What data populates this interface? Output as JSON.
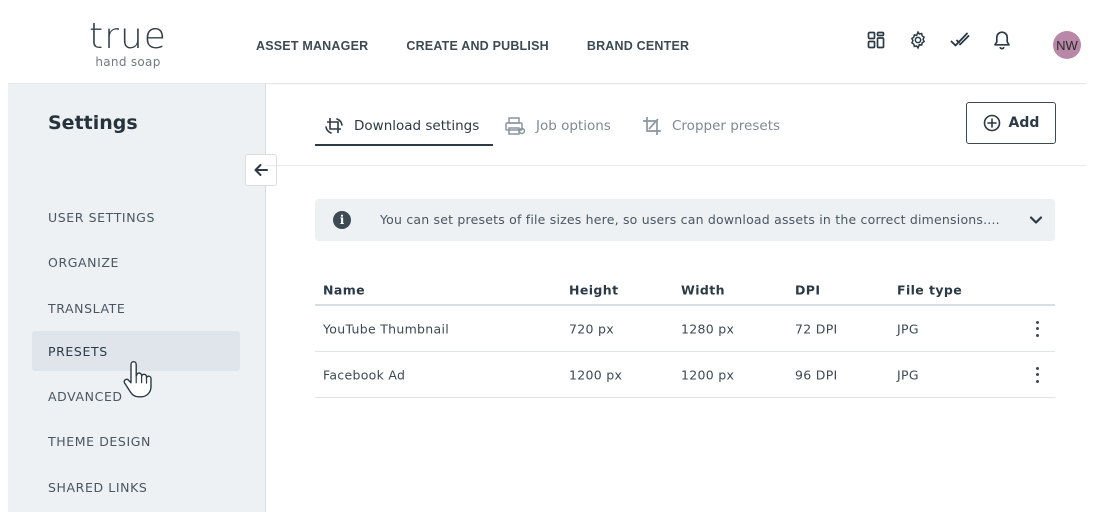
{
  "logo": {
    "word": "true",
    "sub": "hand soap"
  },
  "topnav": {
    "items": [
      "ASSET MANAGER",
      "CREATE AND PUBLISH",
      "BRAND CENTER"
    ]
  },
  "topbar_icons": [
    "apps-grid-icon",
    "gear-icon",
    "double-check-icon",
    "bell-icon"
  ],
  "user": {
    "initials": "NW",
    "avatar_color": "#b987a7"
  },
  "sidebar": {
    "title": "Settings",
    "items": [
      {
        "label": "USER SETTINGS"
      },
      {
        "label": "ORGANIZE"
      },
      {
        "label": "TRANSLATE"
      },
      {
        "label": "PRESETS",
        "active": true
      },
      {
        "label": "ADVANCED"
      },
      {
        "label": "THEME DESIGN"
      },
      {
        "label": "SHARED LINKS"
      }
    ]
  },
  "tabs": [
    {
      "label": "Download settings",
      "icon": "crop-rotate-icon",
      "active": true
    },
    {
      "label": "Job options",
      "icon": "printer-settings-icon"
    },
    {
      "label": "Cropper presets",
      "icon": "crop-icon"
    }
  ],
  "add_button": {
    "label": "Add",
    "icon": "plus-circle-icon"
  },
  "info": {
    "text": "You can set presets of file sizes here, so users can download assets in the correct dimensions...."
  },
  "table": {
    "columns": [
      "Name",
      "Height",
      "Width",
      "DPI",
      "File type"
    ],
    "rows": [
      [
        "YouTube Thumbnail",
        "720 px",
        "1280 px",
        "72 DPI",
        "JPG"
      ],
      [
        "Facebook Ad",
        "1200 px",
        "1200 px",
        "96 DPI",
        "JPG"
      ]
    ]
  },
  "colors": {
    "accent": "#2b3a45",
    "sidebar_bg": "#edf1f4",
    "active_item_bg": "#dfe5ea"
  }
}
